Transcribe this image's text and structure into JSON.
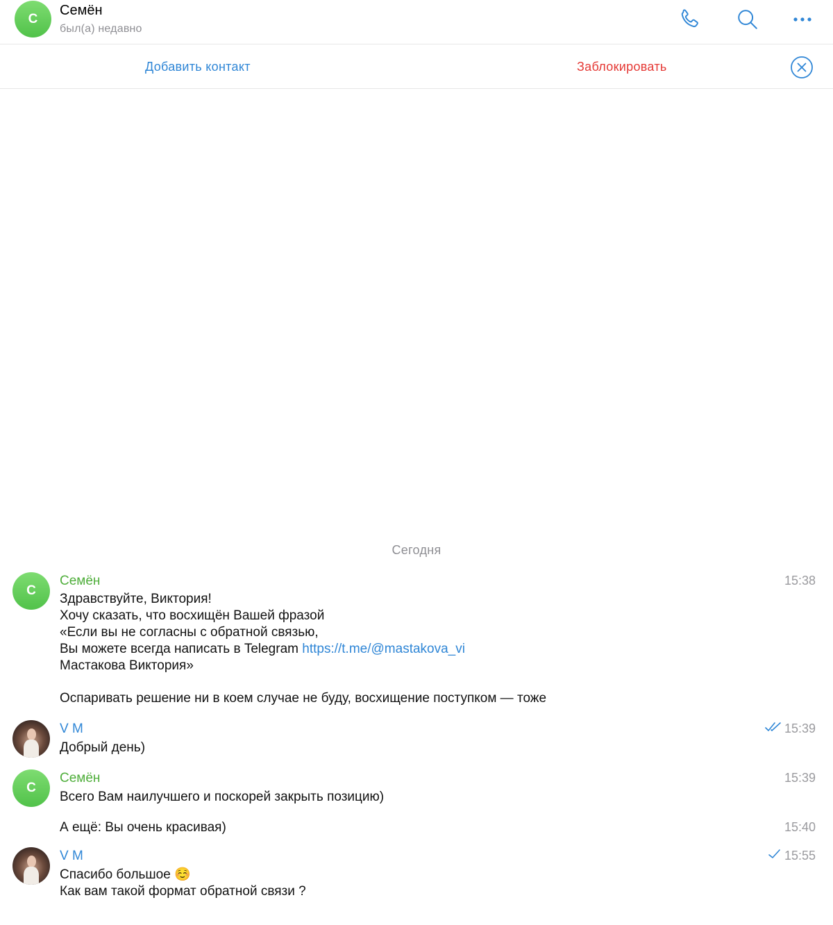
{
  "header": {
    "avatar_letter": "С",
    "name": "Семён",
    "status": "был(а) недавно",
    "icons": [
      "phone-icon",
      "search-icon",
      "more-icon"
    ]
  },
  "actions": {
    "add_contact": "Добавить контакт",
    "block": "Заблокировать",
    "close_icon": "close-circle-icon"
  },
  "chat": {
    "date_separator": "Сегодня",
    "messages": [
      {
        "sender": "Семён",
        "avatar_letter": "С",
        "time": "15:38",
        "line1": "Здравствуйте, Виктория!",
        "line2": "Хочу сказать, что восхищён Вашей фразой",
        "line3": "«Если вы не согласны с обратной связью,",
        "line4_text": "Вы можете всегда написать в Telegram ",
        "line4_link": "https://t.me/@mastakova_vi",
        "line5": "Мастакова Виктория»",
        "line6": "Оспаривать решение ни в коем случае не буду, восхищение поступком — тоже"
      },
      {
        "sender": "V M",
        "time": "15:39",
        "status": "read",
        "line1": "Добрый день)"
      },
      {
        "sender": "Семён",
        "avatar_letter": "С",
        "time": "15:39",
        "line1": "Всего Вам наилучшего и поскорей закрыть позицию)"
      },
      {
        "time": "15:40",
        "line1": "А ещё: Вы очень красивая)"
      },
      {
        "sender": "V M",
        "time": "15:55",
        "status": "sent",
        "line1": "Спасибо большое ",
        "emoji": "☺️",
        "line2": "Как вам такой формат обратной связи ?"
      }
    ]
  },
  "colors": {
    "accent_blue": "#2f86d6",
    "danger_red": "#e53935",
    "sender_green": "#4fae3b",
    "avatar_green": "#5cc852",
    "muted_gray": "#8e8e93"
  }
}
